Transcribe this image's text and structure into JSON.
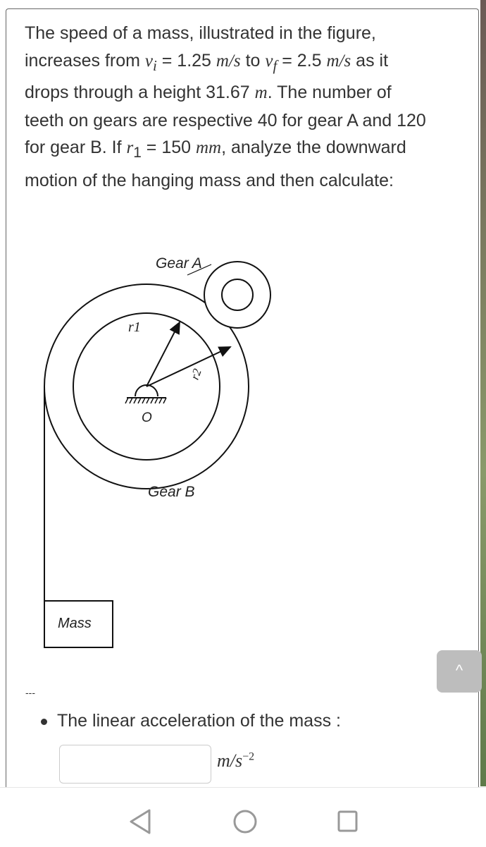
{
  "question": {
    "p1": "The speed of  a mass, illustrated in the figure, increases from ",
    "vi": "v",
    "vi_sub": "i",
    "vi_val": " = 1.25 ",
    "unit_ms": "m/s",
    "p2": " to ",
    "vf": "v",
    "vf_sub": "f",
    "vf_val": " = 2.5 ",
    "p3": " as it drops through a height 31.67 ",
    "m": "m",
    "p4": ". The number of teeth on gears are respective  40 for gear A and 120 for gear B. If ",
    "r1": "r",
    "r1_sub": "1",
    "r1_val": " = 150 ",
    "mm": "mm",
    "p5": ", analyze the downward motion of the hanging mass and then calculate:"
  },
  "figure": {
    "gear_a": "Gear A",
    "gear_b": "Gear B",
    "r1": "r1",
    "r2": "r2",
    "origin": "O",
    "mass": "Mass"
  },
  "separator": "---",
  "part": {
    "label": "The linear acceleration of the mass :",
    "answer_value": "",
    "unit": "m/s",
    "unit_exp": "−2"
  },
  "scroll_up_icon": "chevron-up-icon",
  "nav_icons": [
    "back-triangle-icon",
    "home-circle-icon",
    "recents-square-icon"
  ]
}
